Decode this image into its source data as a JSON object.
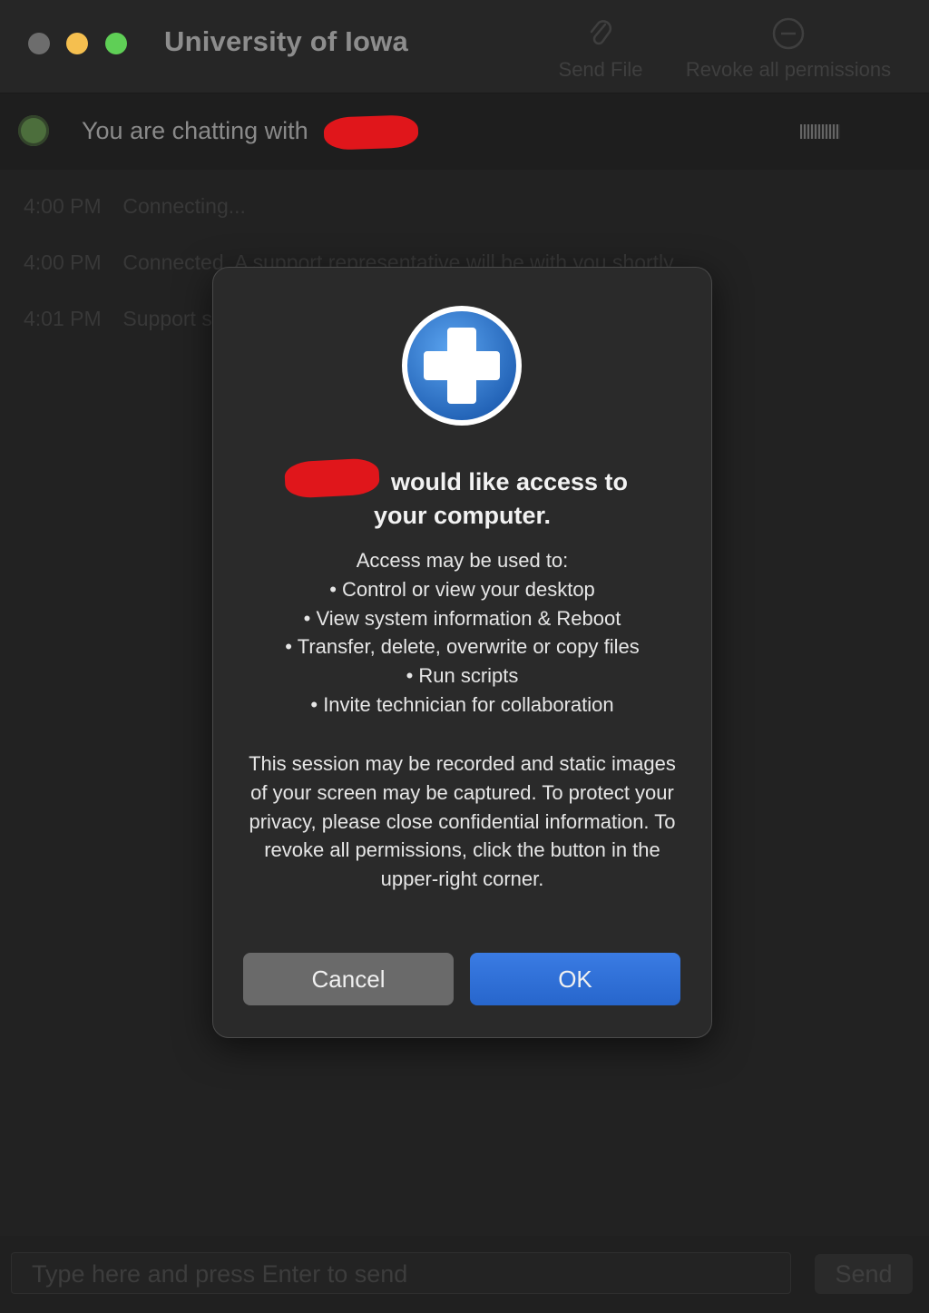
{
  "window": {
    "title": "University of Iowa"
  },
  "toolbar": {
    "send_file_label": "Send File",
    "send_file_icon": "paperclip-icon",
    "revoke_label": "Revoke all permissions",
    "revoke_icon": "minus-circle-icon"
  },
  "status": {
    "text": "You are chatting with",
    "indicator_color": "#4c6e3c"
  },
  "chat": {
    "lines": [
      {
        "time": "4:00 PM",
        "text": "Connecting..."
      },
      {
        "time": "4:00 PM",
        "text": "Connected. A support representative will be with you shortly."
      },
      {
        "time": "4:01 PM",
        "text": "Support s"
      }
    ]
  },
  "dialog": {
    "icon": "plus-cross-icon",
    "title_line1": "would like access to",
    "title_line2": "your computer.",
    "intro": "Access may be used to:",
    "bullets": [
      "• Control or view your desktop",
      "• View system information & Reboot",
      "• Transfer, delete, overwrite or copy files",
      "• Run scripts",
      "• Invite technician for collaboration"
    ],
    "notice": "This session may be recorded and static images of your screen may be captured. To protect your privacy, please close confidential information. To revoke all permissions, click the button in the upper-right corner.",
    "cancel_label": "Cancel",
    "ok_label": "OK"
  },
  "composer": {
    "placeholder": "Type here and press Enter to send",
    "send_label": "Send"
  },
  "colors": {
    "accent": "#2f6fd6",
    "redaction": "#e0161b"
  }
}
